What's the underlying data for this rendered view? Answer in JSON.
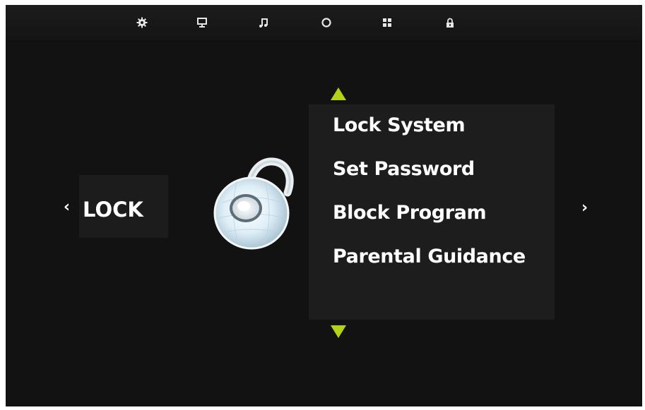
{
  "topbar": {
    "icons": [
      {
        "name": "settings-icon"
      },
      {
        "name": "monitor-icon"
      },
      {
        "name": "music-icon"
      },
      {
        "name": "circle-icon"
      },
      {
        "name": "grid-icon"
      },
      {
        "name": "lock-icon",
        "active": true
      }
    ]
  },
  "category": {
    "label": "LOCK",
    "prev_symbol": "‹",
    "next_symbol": "›",
    "icon": "padlock-icon"
  },
  "menu": {
    "up_arrow": "up-arrow-icon",
    "down_arrow": "down-arrow-icon",
    "items": [
      {
        "label": "Lock System"
      },
      {
        "label": "Set Password"
      },
      {
        "label": "Block Program"
      },
      {
        "label": "Parental Guidance"
      }
    ]
  },
  "colors": {
    "background": "#121212",
    "panel": "#1d1d1d",
    "text": "#ffffff",
    "accent_arrow": "#b5d316"
  }
}
